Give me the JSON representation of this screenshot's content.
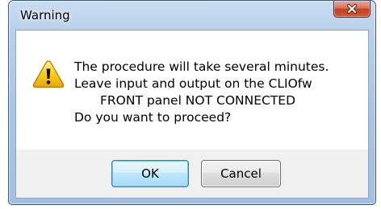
{
  "window": {
    "title": "Warning",
    "close_icon": "close-icon"
  },
  "dialog": {
    "icon": "warning-icon",
    "message_lines": [
      "The procedure will take several minutes.",
      "Leave input and output on the CLIOfw",
      "FRONT panel NOT CONNECTED",
      "Do you want to proceed?"
    ]
  },
  "buttons": {
    "ok_label": "OK",
    "cancel_label": "Cancel"
  },
  "colors": {
    "frame": "#a9c4e3",
    "close_button": "#c2401f",
    "default_button_border": "#3c7fb1",
    "warning_fill": "#f5c400"
  }
}
